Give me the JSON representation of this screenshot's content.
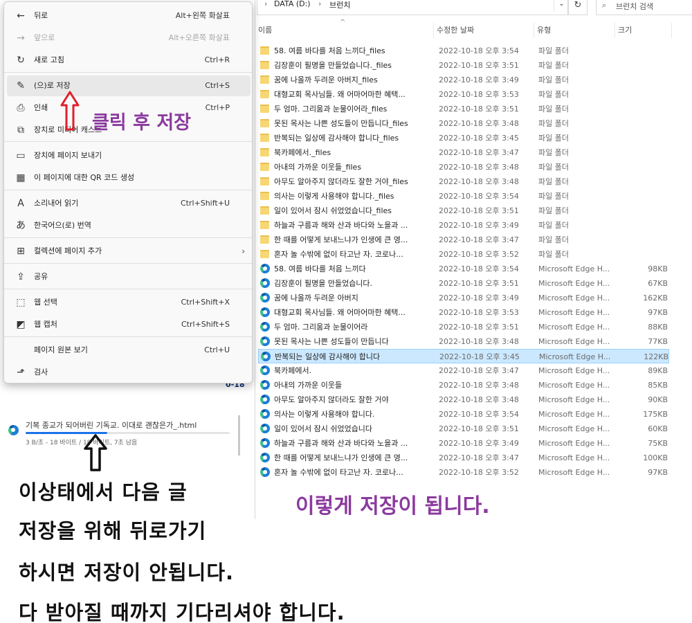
{
  "explorer": {
    "breadcrumb": [
      "DATA (D:)",
      "브런치"
    ],
    "search_placeholder": "브런치 검색",
    "columns": {
      "name": "이름",
      "modified": "수정한 날짜",
      "type": "유형",
      "size": "크기"
    },
    "rows": [
      {
        "kind": "folder",
        "name": "58. 여름 바다를 처음 느끼다_files",
        "date": "2022-10-18 오후 3:54",
        "type": "파일 폴더",
        "size": ""
      },
      {
        "kind": "folder",
        "name": "김장훈이 필명을 만들었습니다._files",
        "date": "2022-10-18 오후 3:51",
        "type": "파일 폴더",
        "size": ""
      },
      {
        "kind": "folder",
        "name": "꿈에 나올까 두려운 아버지_files",
        "date": "2022-10-18 오후 3:49",
        "type": "파일 폴더",
        "size": ""
      },
      {
        "kind": "folder",
        "name": "대형교회 목사님들. 왜 어마어마한 혜택...",
        "date": "2022-10-18 오후 3:53",
        "type": "파일 폴더",
        "size": ""
      },
      {
        "kind": "folder",
        "name": "두 엄마. 그리움과 눈물이어라_files",
        "date": "2022-10-18 오후 3:51",
        "type": "파일 폴더",
        "size": ""
      },
      {
        "kind": "folder",
        "name": "못된 목사는 나쁜 성도들이 만듭니다_files",
        "date": "2022-10-18 오후 3:48",
        "type": "파일 폴더",
        "size": ""
      },
      {
        "kind": "folder",
        "name": "반복되는 일상에 감사해야 합니다_files",
        "date": "2022-10-18 오후 3:45",
        "type": "파일 폴더",
        "size": ""
      },
      {
        "kind": "folder",
        "name": "북카페에서._files",
        "date": "2022-10-18 오후 3:47",
        "type": "파일 폴더",
        "size": ""
      },
      {
        "kind": "folder",
        "name": "아내의 가까운 이웃들_files",
        "date": "2022-10-18 오후 3:48",
        "type": "파일 폴더",
        "size": ""
      },
      {
        "kind": "folder",
        "name": "아무도 알아주지 않더라도 잘한 거야_files",
        "date": "2022-10-18 오후 3:48",
        "type": "파일 폴더",
        "size": ""
      },
      {
        "kind": "folder",
        "name": "의사는 이렇게 사용해야 합니다._files",
        "date": "2022-10-18 오후 3:54",
        "type": "파일 폴더",
        "size": ""
      },
      {
        "kind": "folder",
        "name": "일이 있어서 잠시 쉬었었습니다_files",
        "date": "2022-10-18 오후 3:51",
        "type": "파일 폴더",
        "size": ""
      },
      {
        "kind": "folder",
        "name": "하늘과 구름과 해와 산과 바다와 노을과 ...",
        "date": "2022-10-18 오후 3:49",
        "type": "파일 폴더",
        "size": ""
      },
      {
        "kind": "folder",
        "name": "한 때를 어떻게 보내느냐가 인생에 큰 영...",
        "date": "2022-10-18 오후 3:47",
        "type": "파일 폴더",
        "size": ""
      },
      {
        "kind": "folder",
        "name": "혼자 놀 수밖에 없이 타고난 자. 코로나...",
        "date": "2022-10-18 오후 3:52",
        "type": "파일 폴더",
        "size": ""
      },
      {
        "kind": "edge",
        "name": "58. 여름 바다를 처음 느끼다",
        "date": "2022-10-18 오후 3:54",
        "type": "Microsoft Edge H...",
        "size": "98KB"
      },
      {
        "kind": "edge",
        "name": "김장훈이 필명을 만들었습니다.",
        "date": "2022-10-18 오후 3:51",
        "type": "Microsoft Edge H...",
        "size": "67KB"
      },
      {
        "kind": "edge",
        "name": "꿈에 나올까 두려운 아버지",
        "date": "2022-10-18 오후 3:49",
        "type": "Microsoft Edge H...",
        "size": "162KB"
      },
      {
        "kind": "edge",
        "name": "대형교회 목사님들. 왜 어마어마한 혜택...",
        "date": "2022-10-18 오후 3:53",
        "type": "Microsoft Edge H...",
        "size": "97KB"
      },
      {
        "kind": "edge",
        "name": "두 엄마. 그리움과 눈물이어라",
        "date": "2022-10-18 오후 3:51",
        "type": "Microsoft Edge H...",
        "size": "88KB"
      },
      {
        "kind": "edge",
        "name": "못된 목사는 나쁜 성도들이 만듭니다",
        "date": "2022-10-18 오후 3:48",
        "type": "Microsoft Edge H...",
        "size": "77KB"
      },
      {
        "kind": "edge",
        "name": "반복되는 일상에 감사해야 합니다",
        "date": "2022-10-18 오후 3:45",
        "type": "Microsoft Edge H...",
        "size": "122KB",
        "selected": true
      },
      {
        "kind": "edge",
        "name": "북카페에서.",
        "date": "2022-10-18 오후 3:47",
        "type": "Microsoft Edge H...",
        "size": "89KB"
      },
      {
        "kind": "edge",
        "name": "아내의 가까운 이웃들",
        "date": "2022-10-18 오후 3:48",
        "type": "Microsoft Edge H...",
        "size": "85KB"
      },
      {
        "kind": "edge",
        "name": "아무도 알아주지 않더라도 잘한 거야",
        "date": "2022-10-18 오후 3:48",
        "type": "Microsoft Edge H...",
        "size": "90KB"
      },
      {
        "kind": "edge",
        "name": "의사는 이렇게 사용해야 합니다.",
        "date": "2022-10-18 오후 3:54",
        "type": "Microsoft Edge H...",
        "size": "175KB"
      },
      {
        "kind": "edge",
        "name": "일이 있어서 잠시 쉬었었습니다",
        "date": "2022-10-18 오후 3:51",
        "type": "Microsoft Edge H...",
        "size": "60KB"
      },
      {
        "kind": "edge",
        "name": "하늘과 구름과 해와 산과 바다와 노을과 ...",
        "date": "2022-10-18 오후 3:49",
        "type": "Microsoft Edge H...",
        "size": "75KB"
      },
      {
        "kind": "edge",
        "name": "한 때를 어떻게 보내느냐가 인생에 큰 영...",
        "date": "2022-10-18 오후 3:47",
        "type": "Microsoft Edge H...",
        "size": "100KB"
      },
      {
        "kind": "edge",
        "name": "혼자 놀 수밖에 없이 타고난 자. 코로나...",
        "date": "2022-10-18 오후 3:52",
        "type": "Microsoft Edge H...",
        "size": "97KB"
      }
    ]
  },
  "menu": {
    "items": [
      {
        "icon": "back-arrow-icon",
        "glyph": "←",
        "label": "뒤로",
        "shortcut": "Alt+왼쪽 화살표"
      },
      {
        "icon": "forward-arrow-icon",
        "glyph": "→",
        "label": "앞으로",
        "shortcut": "Alt+오른쪽 화살표",
        "disabled": true
      },
      {
        "icon": "refresh-icon",
        "glyph": "↻",
        "label": "새로 고침",
        "shortcut": "Ctrl+R"
      },
      {
        "icon": "save-as-icon",
        "glyph": "✎",
        "label": "(으)로 저장",
        "shortcut": "Ctrl+S",
        "highlighted": true
      },
      {
        "icon": "print-icon",
        "glyph": "⎙",
        "label": "인쇄",
        "shortcut": "Ctrl+P"
      },
      {
        "icon": "cast-icon",
        "glyph": "⧉",
        "label": "장치로 미디어 캐스트",
        "shortcut": ""
      },
      {
        "icon": "send-to-device-icon",
        "glyph": "▭",
        "label": "장치에 페이지 보내기",
        "shortcut": ""
      },
      {
        "icon": "qr-code-icon",
        "glyph": "▦",
        "label": "이 페이지에 대한 QR 코드 생성",
        "shortcut": ""
      },
      {
        "icon": "read-aloud-icon",
        "glyph": "A",
        "label": "소리내어 읽기",
        "shortcut": "Ctrl+Shift+U"
      },
      {
        "icon": "translate-icon",
        "glyph": "あ",
        "label": "한국어으(로) 번역",
        "shortcut": ""
      },
      {
        "icon": "collections-icon",
        "glyph": "⊞",
        "label": "컬렉션에 페이지 추가",
        "shortcut": "",
        "submenu": true
      },
      {
        "icon": "share-icon",
        "glyph": "⇪",
        "label": "공유",
        "shortcut": ""
      },
      {
        "icon": "web-select-icon",
        "glyph": "⬚",
        "label": "웹 선택",
        "shortcut": "Ctrl+Shift+X"
      },
      {
        "icon": "web-capture-icon",
        "glyph": "◩",
        "label": "웹 캡처",
        "shortcut": "Ctrl+Shift+S"
      },
      {
        "icon": "view-source-icon",
        "glyph": "",
        "label": "페이지 원본 보기",
        "shortcut": "Ctrl+U"
      },
      {
        "icon": "inspect-icon",
        "glyph": "⬏",
        "label": "검사",
        "shortcut": ""
      }
    ]
  },
  "download": {
    "filename": "기복 종교가 되어버린 기독교. 이대로 괜찮은가_.html",
    "status": "3 B/초 - 18 바이트 / 18 바이트, 7초 남음",
    "progress": 0.4,
    "accent": "#1a73e8"
  },
  "background_fragment": "0-18",
  "annotations": {
    "click_then_save": "클릭 후 저장",
    "saved_like_this": "이렇게 저장이 됩니다.",
    "instructions": [
      "이상태에서 다음 글",
      "저장을 위해 뒤로가기",
      "하시면 저장이 안됩니다.",
      "다 받아질 때까지 기다리셔야 합니다."
    ],
    "purple": "#8b3a9e",
    "red_arrow": "#e0202a"
  }
}
